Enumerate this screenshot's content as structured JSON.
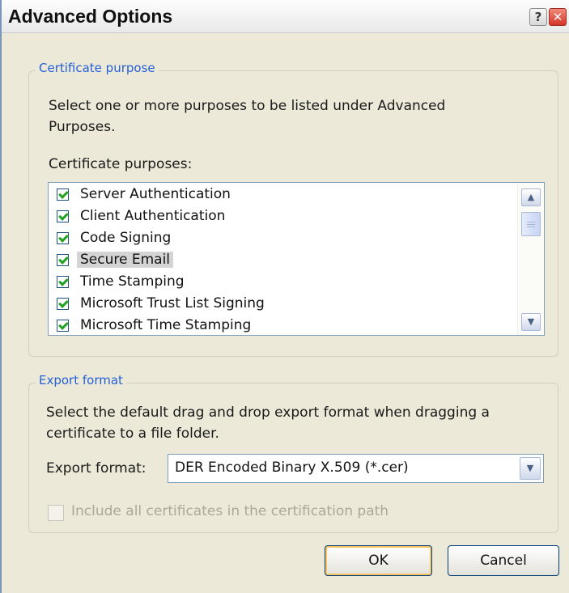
{
  "window": {
    "title": "Advanced Options"
  },
  "titlebar_buttons": {
    "help": "?",
    "close": "✕"
  },
  "certificate_purpose": {
    "legend": "Certificate purpose",
    "description_line1": "Select one or more purposes to be listed under Advanced",
    "description_line2": "Purposes.",
    "list_label": "Certificate purposes:",
    "items": [
      {
        "label": "Server Authentication",
        "checked": true
      },
      {
        "label": "Client Authentication",
        "checked": true
      },
      {
        "label": "Code Signing",
        "checked": true
      },
      {
        "label": "Secure Email",
        "checked": true,
        "selected": true
      },
      {
        "label": "Time Stamping",
        "checked": true
      },
      {
        "label": "Microsoft Trust List Signing",
        "checked": true
      },
      {
        "label": "Microsoft Time Stamping",
        "checked": true
      }
    ]
  },
  "export_format": {
    "legend": "Export format",
    "description_line1": "Select the default drag and drop export format when dragging a",
    "description_line2": "certificate to a file folder.",
    "field_label": "Export format:",
    "selected_value": "DER Encoded Binary X.509 (*.cer)",
    "include_all_label": "Include all certificates in the certification path",
    "include_all_checked": false
  },
  "buttons": {
    "ok": "OK",
    "cancel": "Cancel"
  },
  "colors": {
    "accent": "#2560d6",
    "dialog_bg": "#ece9d8",
    "check": "#21a121"
  }
}
